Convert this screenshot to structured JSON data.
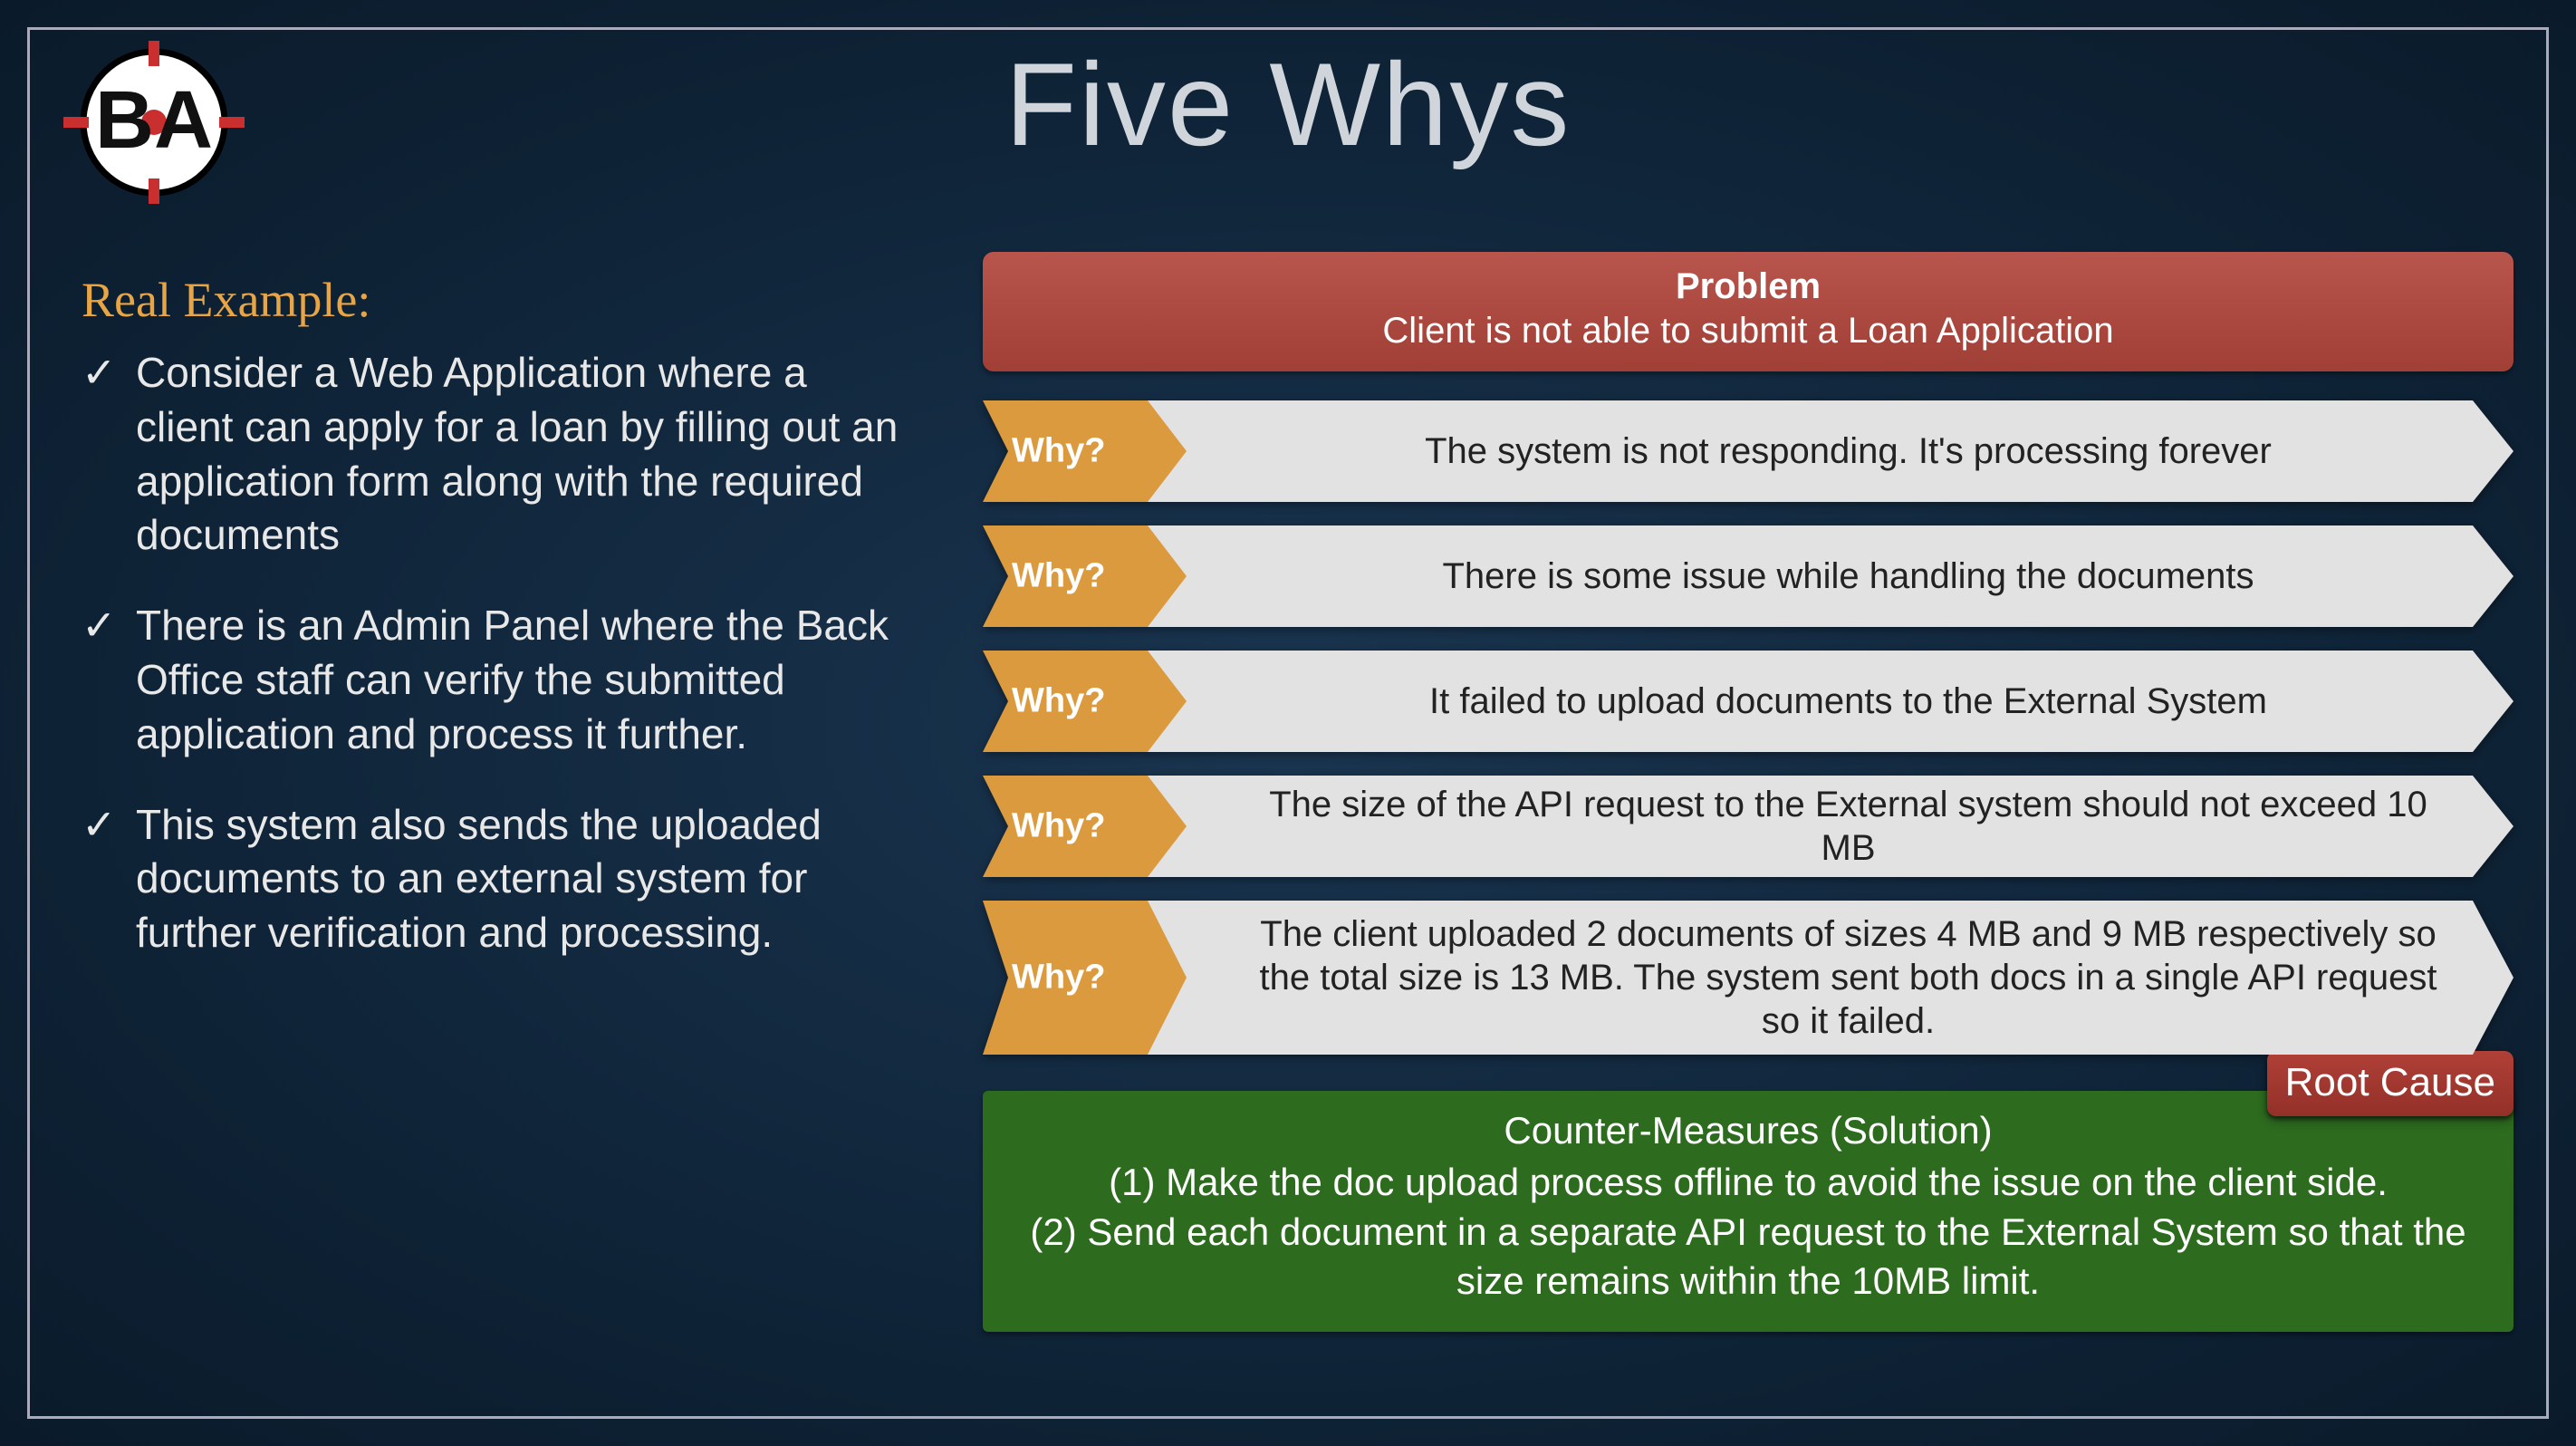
{
  "title": "Five Whys",
  "logo_text": "BA",
  "subtitle": "Real Example:",
  "bullets": [
    "Consider a Web Application where a client can apply for a loan by filling out an application form along with the required documents",
    "There is an Admin Panel where the Back Office staff can verify the submitted application and process it further.",
    "This system also sends the uploaded documents to an external system for further verification and processing."
  ],
  "problem": {
    "label": "Problem",
    "text": "Client is not able to submit a Loan Application"
  },
  "why_label": "Why?",
  "whys": [
    "The system is not responding. It's processing forever",
    "There is some issue while handling the documents",
    "It failed to upload documents to the External System",
    "The size of the API request to the External system should not exceed 10 MB",
    "The client uploaded 2 documents of sizes 4 MB and 9 MB respectively so the total size is 13 MB. The system sent both docs in a single API request so it failed."
  ],
  "root_cause_label": "Root Cause",
  "solution": {
    "title": "Counter-Measures (Solution)",
    "line1": "(1) Make the doc upload process offline to avoid the issue on the client side.",
    "line2": "(2) Send each document in a separate API request to the External System so that the size remains within the 10MB limit."
  }
}
